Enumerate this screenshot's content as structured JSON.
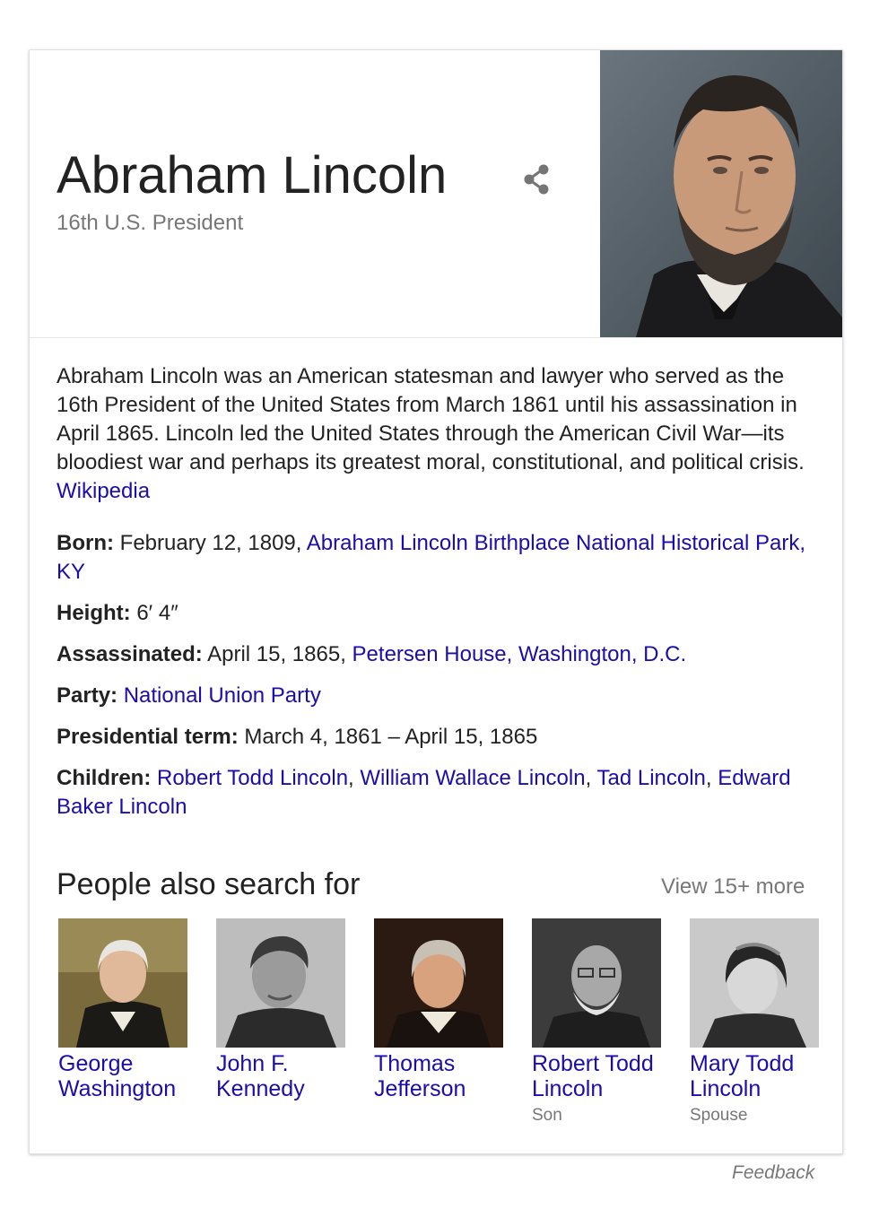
{
  "entity": {
    "title": "Abraham Lincoln",
    "subtitle": "16th U.S. President",
    "share_icon": "share-icon",
    "portrait": "portrait-photo"
  },
  "description": {
    "text": "Abraham Lincoln was an American statesman and lawyer who served as the 16th President of the United States from March 1861 until his assassination in April 1865. Lincoln led the United States through the American Civil War—its bloodiest war and perhaps its greatest moral, constitutional, and political crisis.",
    "source_link": "Wikipedia"
  },
  "facts": {
    "born": {
      "label": "Born:",
      "value": "February 12, 1809,",
      "link": "Abraham Lincoln Birthplace National Historical Park, KY"
    },
    "height": {
      "label": "Height:",
      "value": "6′ 4″"
    },
    "assassinated": {
      "label": "Assassinated:",
      "value": "April 15, 1865,",
      "link": "Petersen House, Washington, D.C."
    },
    "party": {
      "label": "Party:",
      "link": "National Union Party"
    },
    "term": {
      "label": "Presidential term:",
      "value": "March 4, 1861 – April 15, 1865"
    },
    "children": {
      "label": "Children:",
      "items": [
        "Robert Todd Lincoln",
        "William Wallace Lincoln",
        "Tad Lincoln",
        "Edward Baker Lincoln"
      ]
    }
  },
  "people_also_search": {
    "title": "People also search for",
    "view_more": "View 15+ more",
    "people": [
      {
        "name_line1": "George",
        "name_line2": "Washington",
        "relation": ""
      },
      {
        "name_line1": "John F.",
        "name_line2": "Kennedy",
        "relation": ""
      },
      {
        "name_line1": "Thomas",
        "name_line2": "Jefferson",
        "relation": ""
      },
      {
        "name_line1": "Robert Todd",
        "name_line2": "Lincoln",
        "relation": "Son"
      },
      {
        "name_line1": "Mary Todd",
        "name_line2": "Lincoln",
        "relation": "Spouse"
      }
    ]
  },
  "feedback": "Feedback",
  "colors": {
    "link": "#1a0dab",
    "secondary_text": "#777777",
    "primary_text": "#222222"
  }
}
